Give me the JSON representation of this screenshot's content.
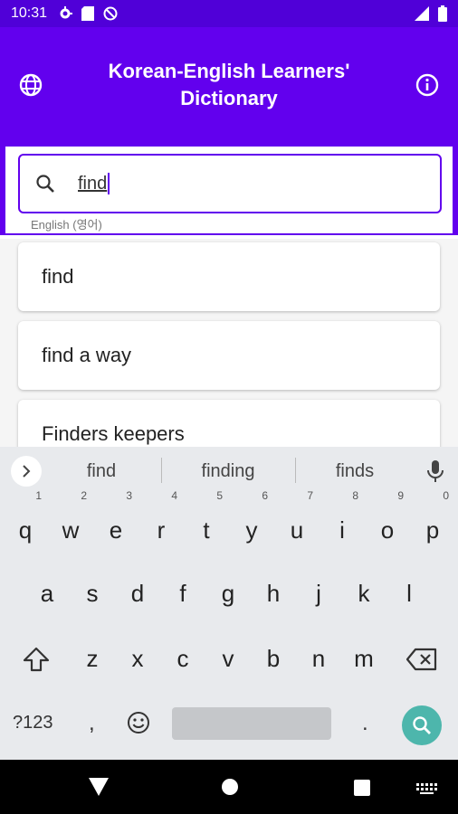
{
  "status_bar": {
    "time": "10:31",
    "left_icons": [
      "gear-icon",
      "sd-card-icon",
      "do-not-disturb-icon"
    ],
    "right_icons": [
      "signal-icon",
      "battery-icon"
    ]
  },
  "app_bar": {
    "title": "Korean-English Learners' Dictionary",
    "left_icon": "globe-icon",
    "right_icon": "info-icon",
    "color": "#6200ee"
  },
  "search": {
    "value": "find",
    "language_hint": "English (영어)",
    "icon": "search-icon"
  },
  "results": [
    {
      "label": "find"
    },
    {
      "label": "find a way"
    },
    {
      "label": "Finders keepers"
    }
  ],
  "keyboard": {
    "suggestions": [
      "find",
      "finding",
      "finds"
    ],
    "row1": [
      {
        "key": "q",
        "num": "1"
      },
      {
        "key": "w",
        "num": "2"
      },
      {
        "key": "e",
        "num": "3"
      },
      {
        "key": "r",
        "num": "4"
      },
      {
        "key": "t",
        "num": "5"
      },
      {
        "key": "y",
        "num": "6"
      },
      {
        "key": "u",
        "num": "7"
      },
      {
        "key": "i",
        "num": "8"
      },
      {
        "key": "o",
        "num": "9"
      },
      {
        "key": "p",
        "num": "0"
      }
    ],
    "row2": [
      "a",
      "s",
      "d",
      "f",
      "g",
      "h",
      "j",
      "k",
      "l"
    ],
    "row3": [
      "z",
      "x",
      "c",
      "v",
      "b",
      "n",
      "m"
    ],
    "symbols_label": "?123",
    "comma_label": ",",
    "period_label": "."
  },
  "nav_bar": {
    "icons": [
      "back-icon",
      "home-icon",
      "recents-icon",
      "keyboard-switch-icon"
    ]
  }
}
